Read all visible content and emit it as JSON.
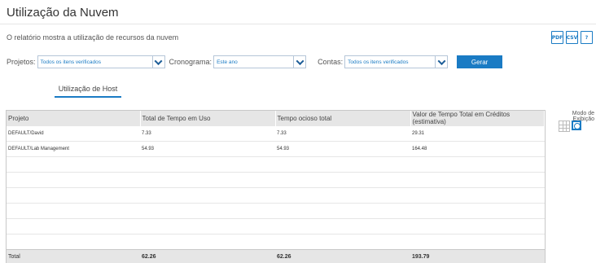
{
  "page": {
    "title": "Utilização da Nuvem",
    "description": "O relatório mostra a utilização de recursos da nuvem"
  },
  "export_icons": [
    {
      "name": "pdf-export-icon",
      "label": "PDF"
    },
    {
      "name": "csv-export-icon",
      "label": "CSV"
    },
    {
      "name": "help-icon",
      "label": "?"
    }
  ],
  "filters": {
    "projetos_label": "Projetos:",
    "projetos_value": "Todos os itens verificados",
    "cronograma_label": "Cronograma:",
    "cronograma_value": "Este ano",
    "contas_label": "Contas:",
    "contas_value": "Todos os itens verificados",
    "gerar_label": "Gerar"
  },
  "tabs": [
    {
      "label": "Utilização de Host"
    }
  ],
  "table": {
    "columns": [
      "Projeto",
      "Total de Tempo em Uso",
      "Tempo ocioso total",
      "Valor de Tempo Total em Créditos (estimativa)"
    ],
    "rows": [
      [
        "DEFAULT/David",
        "7.33",
        "7.33",
        "29.31"
      ],
      [
        "DEFAULT/Lab Management",
        "54.93",
        "54.93",
        "164.48"
      ]
    ],
    "total": [
      "Total",
      "62.26",
      "62.26",
      "193.79"
    ]
  },
  "view_mode": {
    "label": "Modo de Exibição"
  },
  "colors": {
    "accent": "#1a7bc4",
    "header_bg": "#e6e6e6"
  }
}
